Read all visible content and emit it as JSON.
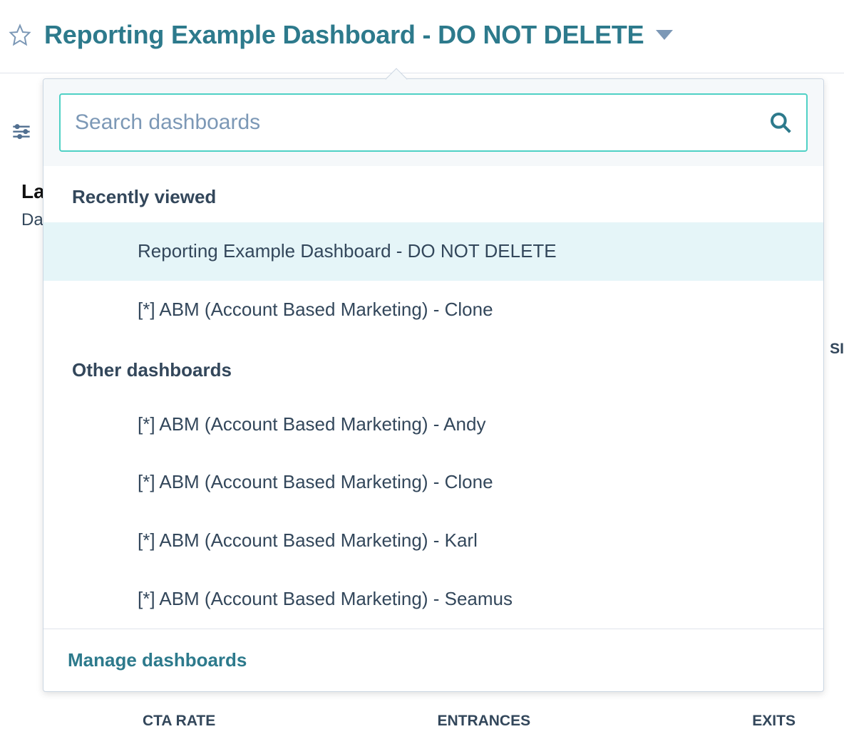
{
  "header": {
    "title": "Reporting Example Dashboard - DO NOT DELETE"
  },
  "background": {
    "panel_title_partial": "La",
    "panel_sub_partial": "Da",
    "right_edge_partial": "SI",
    "columns": [
      "CTA RATE",
      "ENTRANCES",
      "EXITS"
    ]
  },
  "dropdown": {
    "search": {
      "placeholder": "Search dashboards"
    },
    "sections": [
      {
        "title": "Recently viewed",
        "items": [
          {
            "label": "Reporting Example Dashboard - DO NOT DELETE",
            "highlighted": true
          },
          {
            "label": "[*] ABM (Account Based Marketing) - Clone",
            "highlighted": false
          }
        ]
      },
      {
        "title": "Other dashboards",
        "items": [
          {
            "label": "[*] ABM (Account Based Marketing) - Andy",
            "highlighted": false
          },
          {
            "label": "[*] ABM (Account Based Marketing) - Clone",
            "highlighted": false
          },
          {
            "label": "[*] ABM (Account Based Marketing) - Karl",
            "highlighted": false
          },
          {
            "label": "[*] ABM (Account Based Marketing) - Seamus",
            "highlighted": false
          }
        ]
      }
    ],
    "footer": {
      "manage_label": "Manage dashboards"
    }
  }
}
